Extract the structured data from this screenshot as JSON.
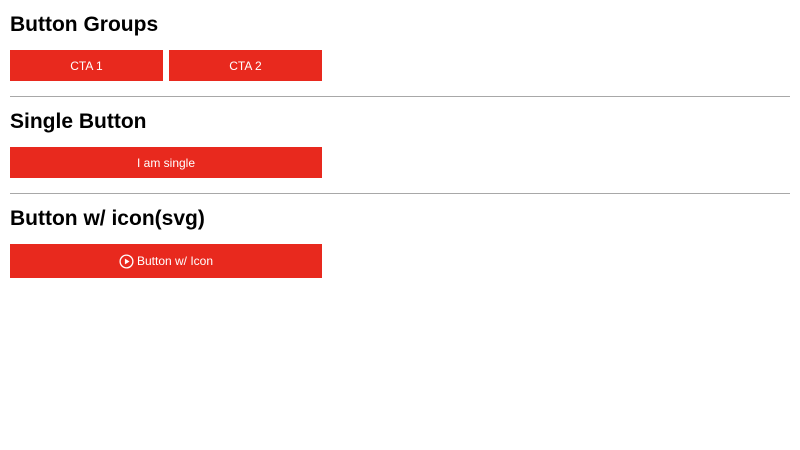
{
  "sections": [
    {
      "heading": "Button Groups",
      "buttons": [
        "CTA 1",
        "CTA 2"
      ]
    },
    {
      "heading": "Single Button",
      "buttons": [
        "I am single"
      ]
    },
    {
      "heading": "Button w/ icon(svg)",
      "buttons": [
        "Button w/ Icon"
      ],
      "icon": "play-circle-icon"
    }
  ],
  "colors": {
    "button_bg": "#e8291e",
    "button_text": "#ffffff",
    "divider": "#a8a8a8"
  }
}
